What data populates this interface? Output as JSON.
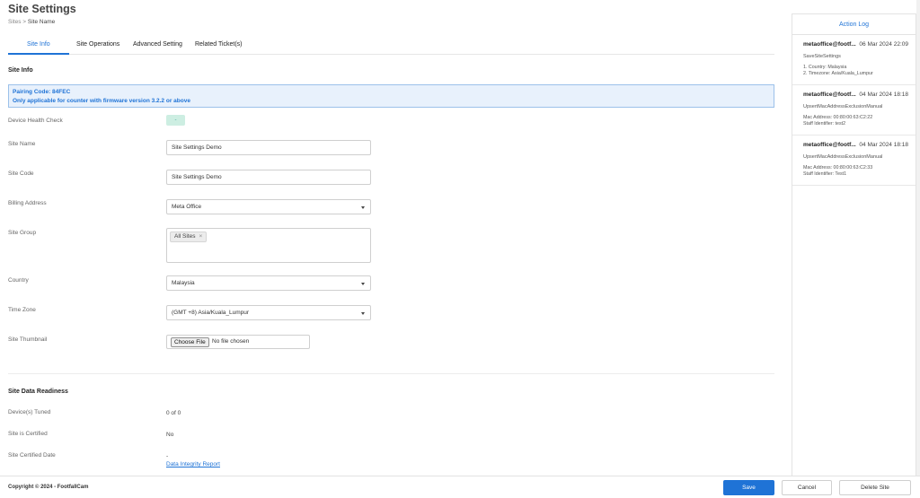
{
  "header": {
    "title": "Site Settings",
    "breadcrumb_parent": "Sites",
    "breadcrumb_sep": ">",
    "breadcrumb_current": "Site Name"
  },
  "tabs": [
    {
      "label": "Site Info",
      "active": true
    },
    {
      "label": "Site Operations",
      "active": false
    },
    {
      "label": "Advanced Setting",
      "active": false
    },
    {
      "label": "Related Ticket(s)",
      "active": false
    }
  ],
  "site_info": {
    "heading": "Site Info",
    "pairing_code_line": "Pairing Code: 84FEC",
    "pairing_note": "Only applicable for counter with firmware version 3.2.2 or above",
    "device_health_label": "Device Health Check",
    "device_health_value": "-",
    "site_name_label": "Site Name",
    "site_name_value": "Site Settings Demo",
    "site_code_label": "Site Code",
    "site_code_value": "Site Settings Demo",
    "billing_label": "Billing Address",
    "billing_value": "Meta Office",
    "site_group_label": "Site Group",
    "site_group_chip": "All Sites",
    "site_group_chip_remove": "×",
    "country_label": "Country",
    "country_value": "Malaysia",
    "timezone_label": "Time Zone",
    "timezone_value": "(GMT +8) Asia/Kuala_Lumpur",
    "thumbnail_label": "Site Thumbnail",
    "file_button": "Choose File",
    "file_status": "No file chosen"
  },
  "readiness": {
    "heading": "Site Data Readiness",
    "tuned_label": "Device(s) Tuned",
    "tuned_value": "0 of 0",
    "certified_label": "Site is Certified",
    "certified_value": "No",
    "certified_date_label": "Site Certified Date",
    "certified_date_value": "-",
    "report_link": "Data Integrity Report"
  },
  "action_log": {
    "title": "Action Log",
    "entries": [
      {
        "user": "metaoffice@footf...",
        "date": "06 Mar 2024 22:09",
        "action": "SaveSiteSettings",
        "line1": "1. Country: Malaysia",
        "line2": "2. Timezone: Asia/Kuala_Lumpur"
      },
      {
        "user": "metaoffice@footf...",
        "date": "04 Mar 2024 18:18",
        "action": "UpsertMacAddressExclusionManual",
        "line1": "Mac Address: 00:80:00:63:C2:22",
        "line2": "Staff Identifier: test2"
      },
      {
        "user": "metaoffice@footf...",
        "date": "04 Mar 2024 18:18",
        "action": "UpsertMacAddressExclusionManual",
        "line1": "Mac Address: 00:80:00:63:C2:33",
        "line2": "Staff Identifier: Test1"
      }
    ]
  },
  "footer": {
    "copyright": "Copyright © 2024 - FootfallCam",
    "save": "Save",
    "cancel": "Cancel",
    "delete": "Delete Site"
  },
  "colors": {
    "accent": "#1f73d6",
    "health_badge": "#cdeee2",
    "pairing_bg": "#e8f1fc"
  }
}
